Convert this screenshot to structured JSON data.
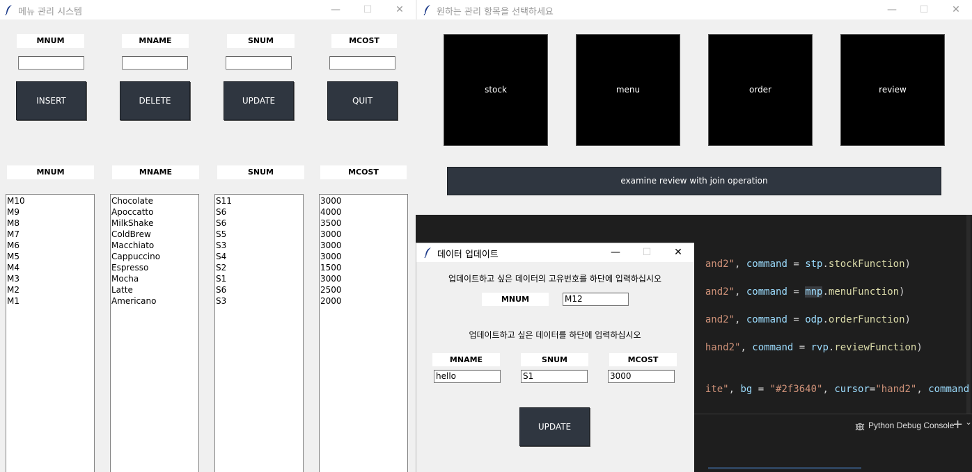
{
  "left_window": {
    "title": "메뉴 관리 시스템",
    "controls": {
      "minimize": "—",
      "maximize": "☐",
      "close": "✕"
    },
    "field_labels": [
      "MNUM",
      "MNAME",
      "SNUM",
      "MCOST"
    ],
    "buttons": [
      "INSERT",
      "DELETE",
      "UPDATE",
      "QUIT"
    ],
    "list_headers": [
      "MNUM",
      "MNAME",
      "SNUM",
      "MCOST"
    ],
    "mnum": [
      "M10",
      "M9",
      "M8",
      "M7",
      "M6",
      "M5",
      "M4",
      "M3",
      "M2",
      "M1"
    ],
    "mname": [
      "Chocolate",
      "Apoccatto",
      "MilkShake",
      "ColdBrew",
      "Macchiato",
      "Cappuccino",
      "Espresso",
      "Mocha",
      "Latte",
      "Americano"
    ],
    "snum": [
      "S11",
      "S6",
      "S6",
      "S5",
      "S3",
      "S4",
      "S2",
      "S1",
      "S6",
      "S3"
    ],
    "mcost": [
      "3000",
      "4000",
      "3500",
      "3000",
      "3000",
      "3000",
      "1500",
      "3000",
      "2500",
      "2000"
    ]
  },
  "right_window": {
    "title": "원하는 관리 항목을 선택하세요",
    "controls": {
      "minimize": "—",
      "maximize": "☐",
      "close": "✕"
    },
    "tiles": [
      "stock",
      "menu",
      "order",
      "review"
    ],
    "join_button": "examine review with join operation"
  },
  "editor": {
    "line1": {
      "prefix": "and2\"",
      "sep": ", ",
      "kw": "command",
      "eq": " = ",
      "obj": "stp",
      "fn": "stockFunction",
      "end": ")"
    },
    "line2": {
      "prefix": "and2\"",
      "sep": ", ",
      "kw": "command",
      "eq": " = ",
      "obj": "mnp",
      "fn": "menuFunction",
      "end": ")"
    },
    "line3": {
      "prefix": "and2\"",
      "sep": ", ",
      "kw": "command",
      "eq": " = ",
      "obj": "odp",
      "fn": "orderFunction",
      "end": ")"
    },
    "line4": {
      "prefix": "hand2\"",
      "sep": ", ",
      "kw": "command",
      "eq": " = ",
      "obj": "rvp",
      "fn": "reviewFunction",
      "end": ")"
    },
    "line5": {
      "prefix": "ite\"",
      "sep": ", ",
      "kw1": "bg",
      "eq1": " = ",
      "val1": "\"#2f3640\"",
      "sep2": ", ",
      "kw2": "cursor",
      "eq2": "=",
      "val2": "\"hand2\"",
      "sep3": ", ",
      "kw3": "command"
    },
    "panel_label": "Python Debug Console",
    "plus": "+",
    "chevron": "⌄"
  },
  "dialog": {
    "title": "데이터 업데이트",
    "controls": {
      "minimize": "—",
      "maximize": "☐",
      "close": "✕"
    },
    "instruction1": "업데이트하고 싶은 데이터의 고유번호를 하단에 입력하십시오",
    "key_label": "MNUM",
    "key_value": "M12",
    "instruction2": "업데이트하고 싶은 데이터를 하단에 입력하십시오",
    "field_labels": [
      "MNAME",
      "SNUM",
      "MCOST"
    ],
    "field_values": [
      "hello",
      "S1",
      "3000"
    ],
    "button": "UPDATE"
  },
  "colors": {
    "button_bg": "#2f3640",
    "tile_bg": "#000000",
    "editor_bg": "#1e1e1e"
  }
}
